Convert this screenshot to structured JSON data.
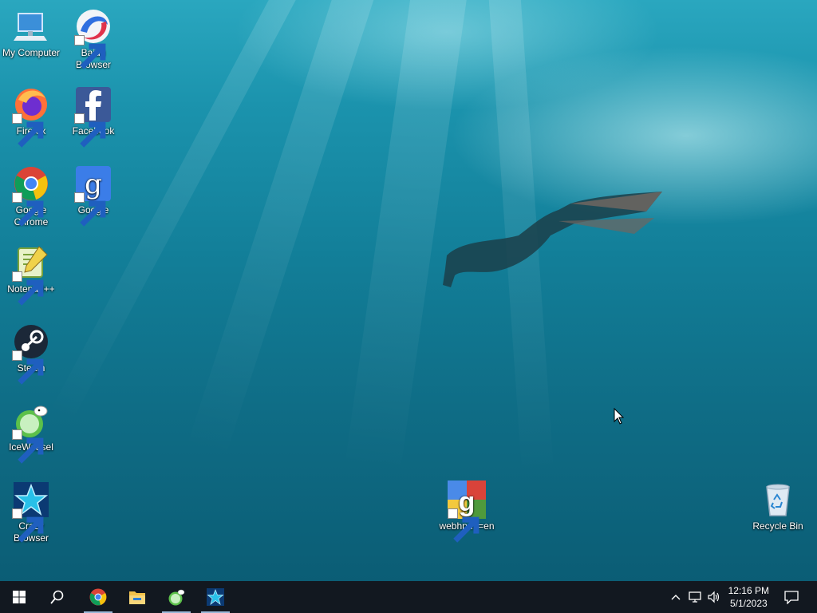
{
  "desktop": {
    "icons": [
      {
        "label": "My Computer",
        "icon": "computer-icon"
      },
      {
        "label": "Baidu Browser",
        "icon": "baidu-browser-icon"
      },
      {
        "label": "Firefox",
        "icon": "firefox-icon"
      },
      {
        "label": "Facebook",
        "icon": "facebook-icon"
      },
      {
        "label": "Google Chrome",
        "icon": "chrome-icon"
      },
      {
        "label": "Google",
        "icon": "google-icon"
      },
      {
        "label": "Notepad++",
        "icon": "notepad-plus-plus-icon"
      },
      {
        "label": "Steam",
        "icon": "steam-icon"
      },
      {
        "label": "IceWeasel",
        "icon": "iceweasel-icon"
      },
      {
        "label": "Crazy Browser",
        "icon": "crazy-browser-icon"
      },
      {
        "label": "webhp-hl=en",
        "icon": "google-maps-icon"
      },
      {
        "label": "Recycle Bin",
        "icon": "recycle-bin-icon"
      }
    ]
  },
  "taskbar": {
    "start": "windows-logo-icon",
    "search": "search-icon",
    "pinned": [
      "chrome-icon",
      "file-explorer-icon",
      "iceweasel-icon",
      "crazy-browser-icon"
    ],
    "tray": [
      "chevron-up-icon",
      "network-icon",
      "volume-icon"
    ],
    "clock": {
      "time": "12:16 PM",
      "date": "5/1/2023"
    },
    "notifications": "action-center-icon"
  }
}
